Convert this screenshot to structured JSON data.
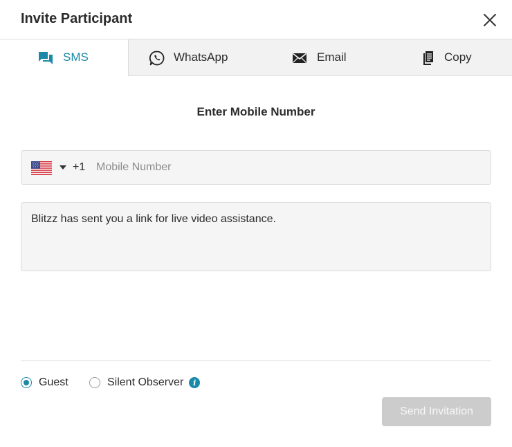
{
  "dialog": {
    "title": "Invite Participant"
  },
  "tabs": [
    {
      "label": "SMS",
      "icon": "chat-bubbles-icon",
      "active": true
    },
    {
      "label": "WhatsApp",
      "icon": "whatsapp-icon",
      "active": false
    },
    {
      "label": "Email",
      "icon": "envelope-icon",
      "active": false
    },
    {
      "label": "Copy",
      "icon": "copy-document-icon",
      "active": false
    }
  ],
  "form": {
    "section_title": "Enter Mobile Number",
    "country_flag": "us-flag-icon",
    "dial_code": "+1",
    "phone_placeholder": "Mobile Number",
    "phone_value": "",
    "message": "Blitzz has sent you a link for live video assistance."
  },
  "roles": {
    "options": [
      {
        "label": "Guest",
        "selected": true
      },
      {
        "label": "Silent Observer",
        "selected": false
      }
    ],
    "info_icon": "info-icon"
  },
  "actions": {
    "send_label": "Send Invitation",
    "send_enabled": false
  },
  "colors": {
    "accent": "#1a8aa8",
    "tab_inactive_bg": "#f2f2f2",
    "border": "#dcdcdc",
    "disabled_button": "#cccccc"
  }
}
